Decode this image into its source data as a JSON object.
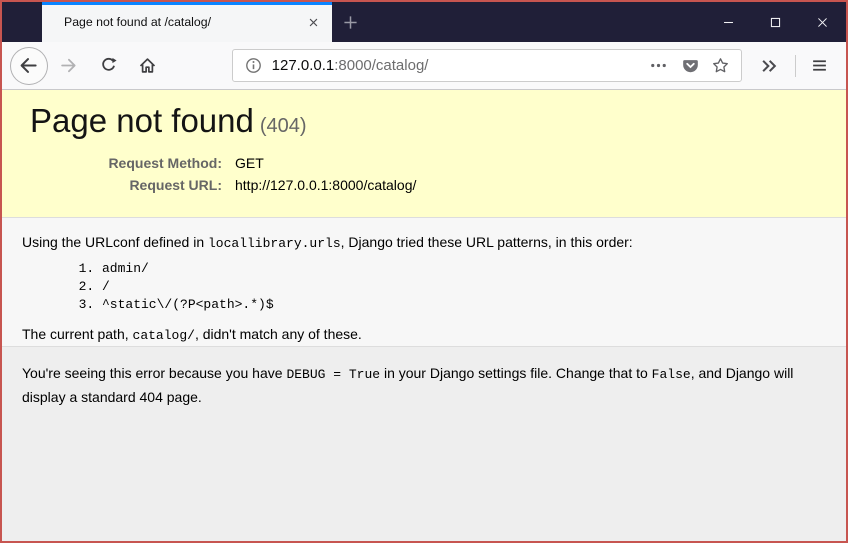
{
  "browser": {
    "tab": {
      "title": "Page not found at /catalog/"
    },
    "url": {
      "host": "127.0.0.1",
      "rest": ":8000/catalog/"
    },
    "accent_color": "#0a84ff"
  },
  "page": {
    "summary": {
      "title": "Page not found",
      "status_code": "(404)",
      "rows": [
        {
          "label": "Request Method:",
          "value": "GET"
        },
        {
          "label": "Request URL:",
          "value": "http://127.0.0.1:8000/catalog/"
        }
      ]
    },
    "info": {
      "intro_prefix": "Using the URLconf defined in ",
      "intro_code": "locallibrary.urls",
      "intro_suffix": ", Django tried these URL patterns, in this order:",
      "patterns": [
        "admin/",
        "/",
        "^static\\/(?P<path>.*)$"
      ],
      "current_prefix": "The current path, ",
      "current_code": "catalog/",
      "current_suffix": ", didn't match any of these."
    },
    "explanation": {
      "part1": "You're seeing this error because you have ",
      "code1": "DEBUG = True",
      "part2": " in your Django settings file. Change that to ",
      "code2": "False",
      "part3": ", and Django will display a standard 404 page."
    }
  },
  "colors": {
    "frame_border": "#c75550",
    "titlebar_bg": "#201f38",
    "tab_accent": "#0a84ff",
    "summary_bg": "#ffffcc",
    "info_bg": "#f7f7f7",
    "explanation_bg": "#eeeeee",
    "label_gray": "#666666"
  }
}
